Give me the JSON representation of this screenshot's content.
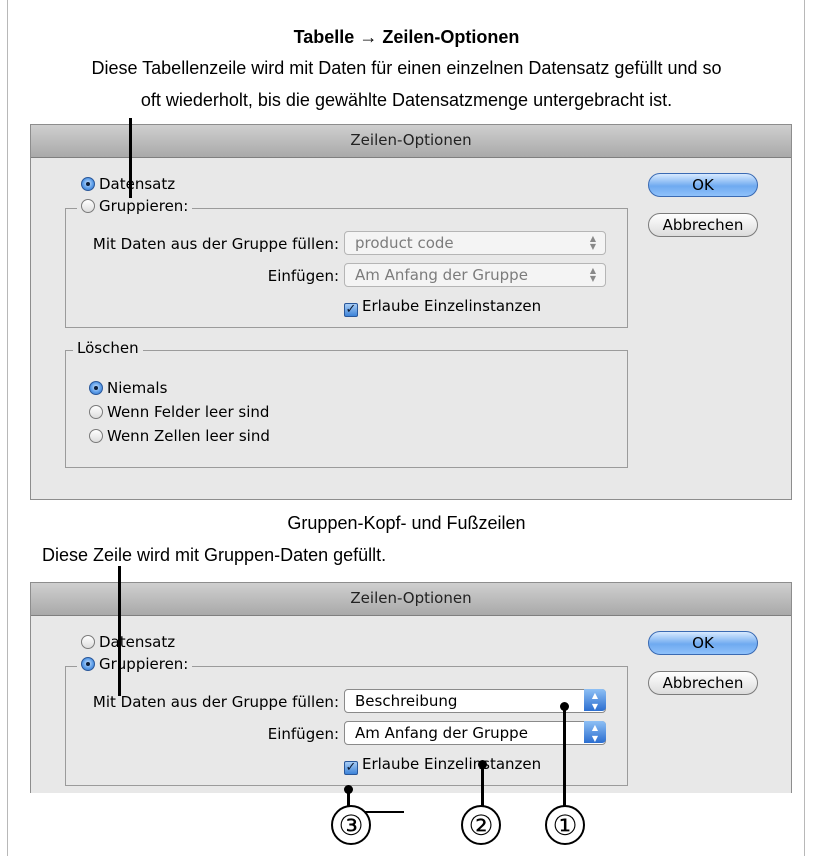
{
  "heading": {
    "prefix": "Tabelle",
    "arrow": "→",
    "suffix": "Zeilen-Optionen"
  },
  "description_line1": "Diese Tabellenzeile wird mit Daten für einen einzelnen Datensatz gefüllt und so",
  "description_line2": "oft wiederholt, bis die gewählte Datensatzmenge untergebracht ist.",
  "subheading": "Gruppen-Kopf- und Fußzeilen",
  "caption": "Diese Zeile wird mit Gruppen-Daten gefüllt.",
  "dialog1": {
    "title": "Zeilen-Optionen",
    "radio_datensatz": "Datensatz",
    "radio_gruppieren": "Gruppieren:",
    "fill_label": "Mit Daten aus der Gruppe füllen:",
    "fill_value": "product code",
    "insert_label": "Einfügen:",
    "insert_value": "Am Anfang der Gruppe",
    "checkbox_label": "Erlaube Einzelinstanzen",
    "delete_legend": "Löschen",
    "radio_niemals": "Niemals",
    "radio_felder": "Wenn Felder leer sind",
    "radio_zellen": "Wenn Zellen leer sind",
    "ok": "OK",
    "cancel": "Abbrechen"
  },
  "dialog2": {
    "title": "Zeilen-Optionen",
    "radio_datensatz": "Datensatz",
    "radio_gruppieren": "Gruppieren:",
    "fill_label": "Mit Daten aus der Gruppe füllen:",
    "fill_value": "Beschreibung",
    "insert_label": "Einfügen:",
    "insert_value": "Am Anfang der Gruppe",
    "checkbox_label": "Erlaube Einzelinstanzen",
    "ok": "OK",
    "cancel": "Abbrechen"
  },
  "callouts": [
    "③",
    "②",
    "①"
  ],
  "colors": {
    "accent": "#3d83d8",
    "titlebar": "#bdbdbd",
    "dialog_bg": "#e8e8e8"
  }
}
